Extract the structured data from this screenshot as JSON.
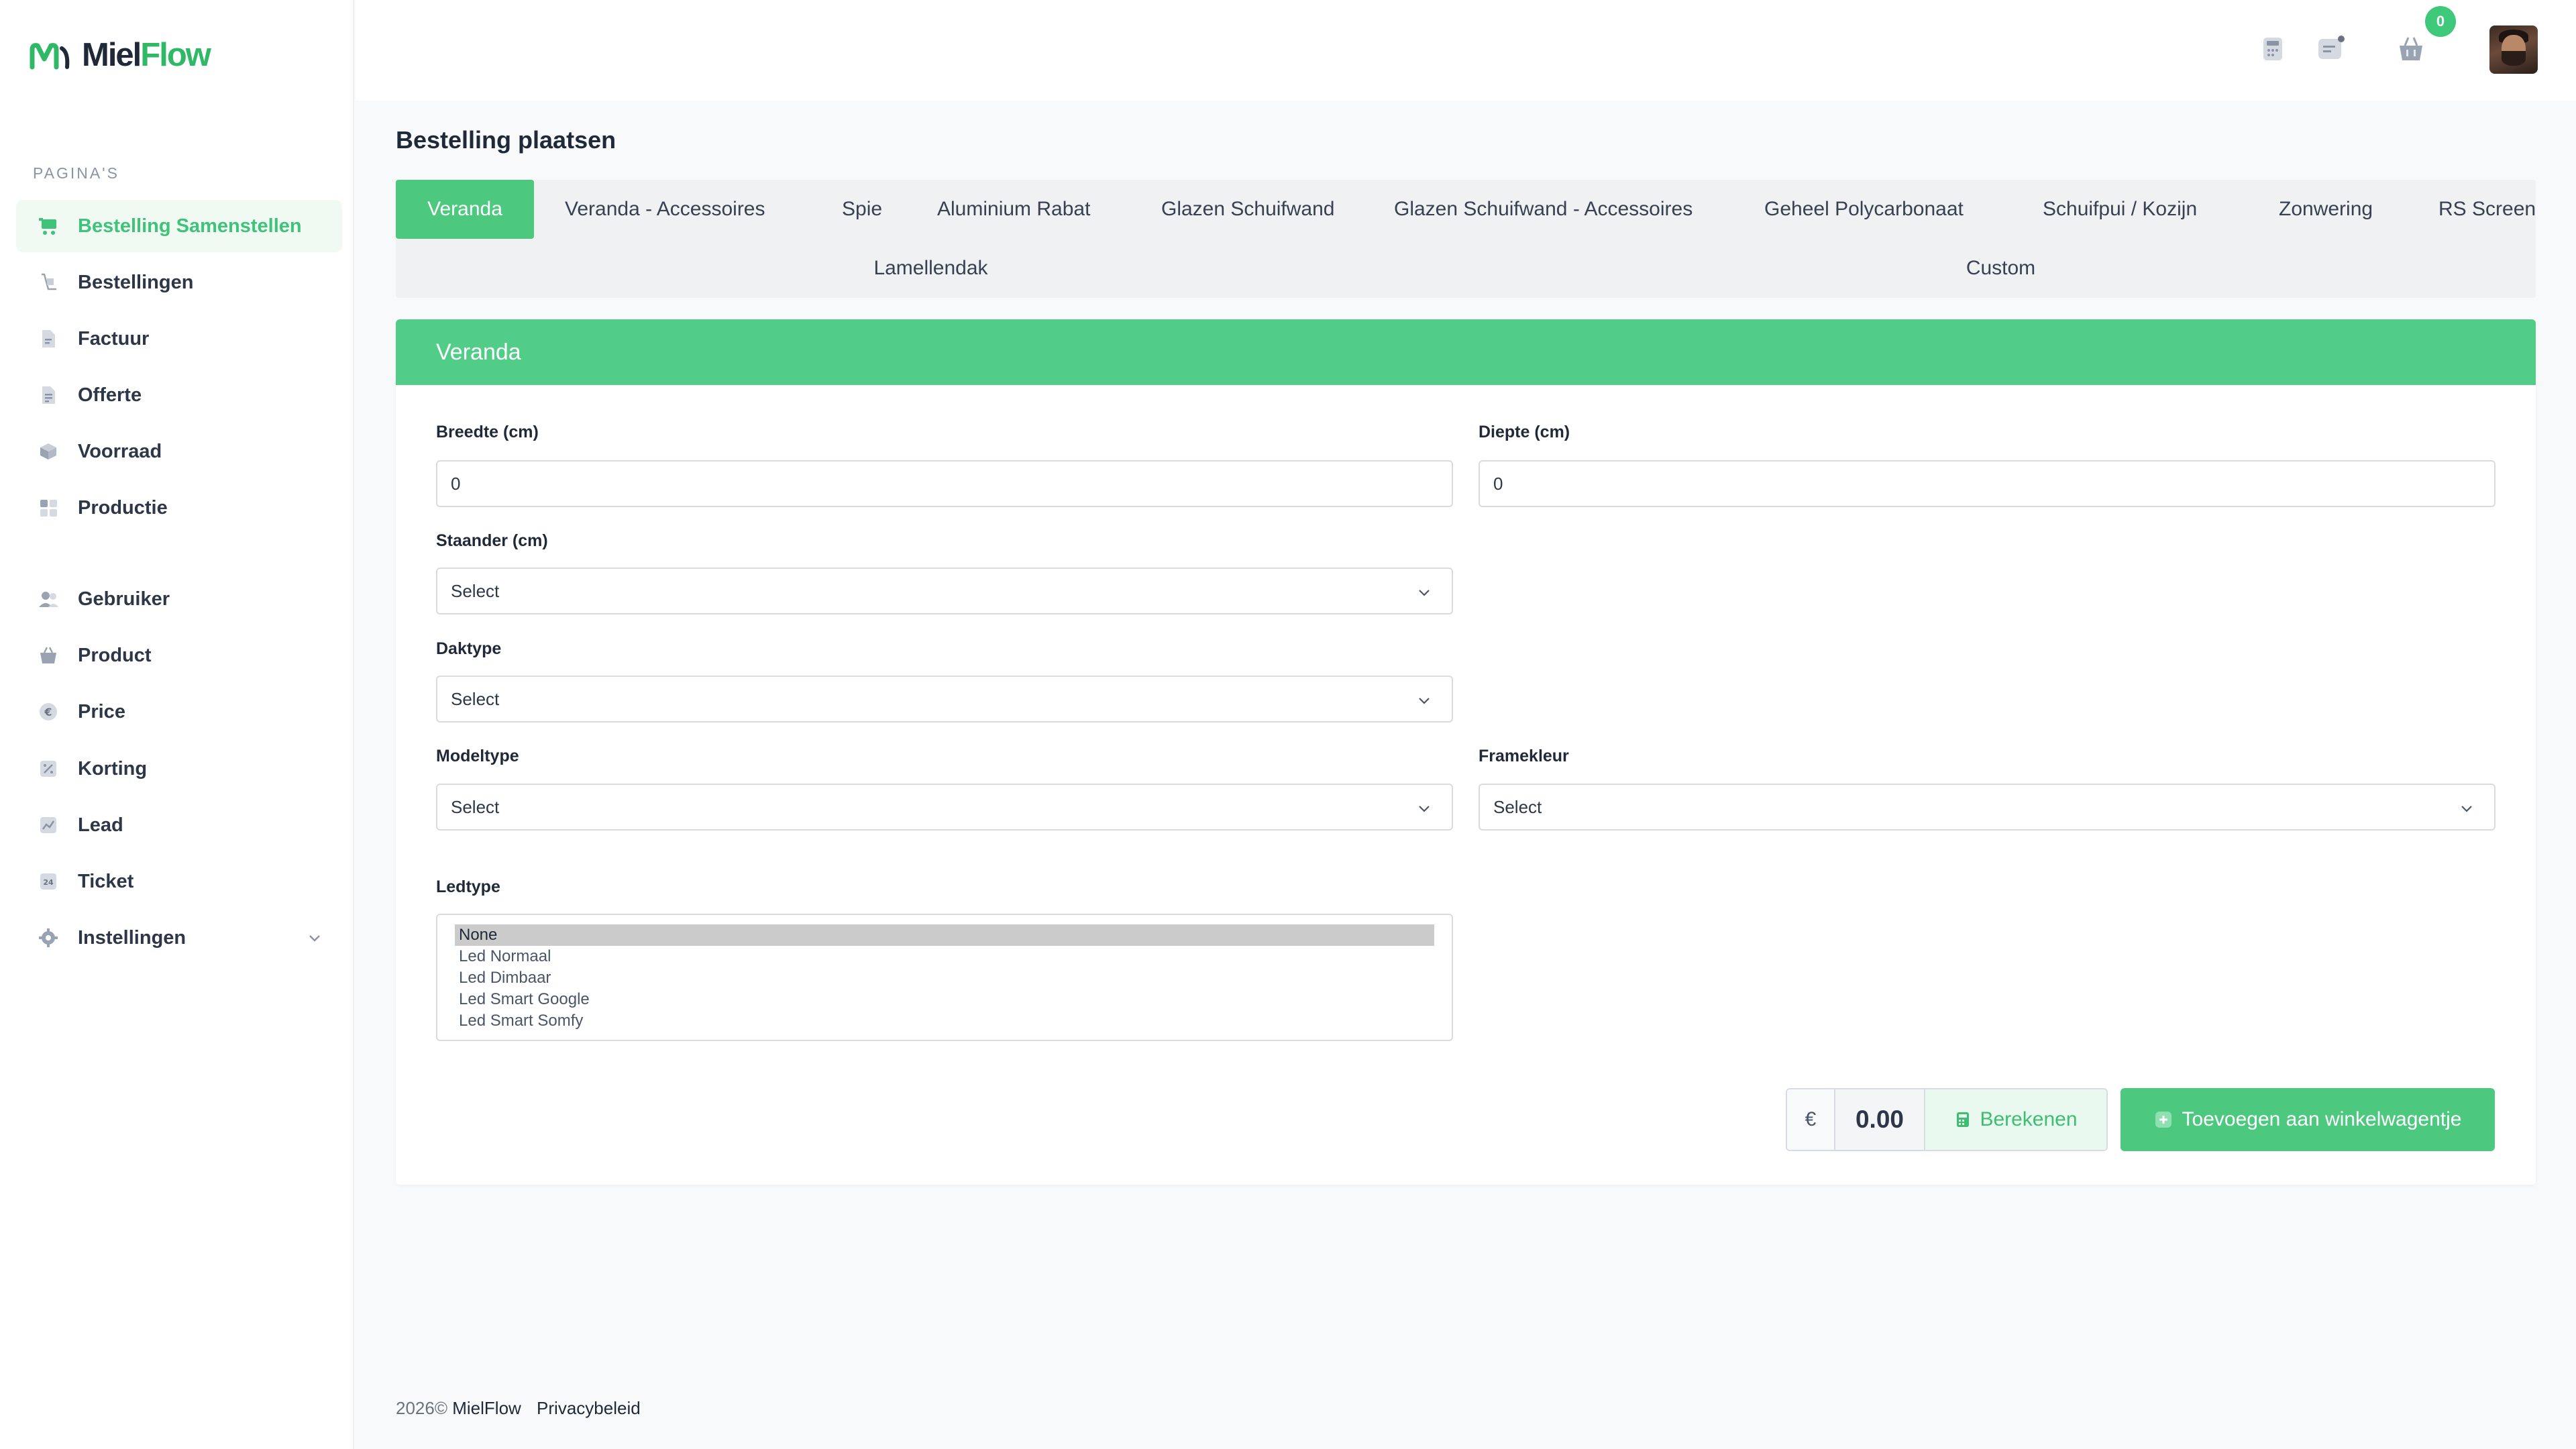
{
  "app": {
    "logo_prefix": "Miel",
    "logo_suffix": "Flow"
  },
  "sidebar": {
    "section_label": "PAGINA'S",
    "items": [
      {
        "label": "Bestelling Samenstellen",
        "icon": "cart-icon",
        "active": true
      },
      {
        "label": "Bestellingen",
        "icon": "orders-icon"
      },
      {
        "label": "Factuur",
        "icon": "invoice-icon"
      },
      {
        "label": "Offerte",
        "icon": "quote-icon"
      },
      {
        "label": "Voorraad",
        "icon": "stock-icon"
      },
      {
        "label": "Productie",
        "icon": "production-icon"
      },
      {
        "label": "Gebruiker",
        "icon": "users-icon"
      },
      {
        "label": "Product",
        "icon": "basket-icon"
      },
      {
        "label": "Price",
        "icon": "euro-icon"
      },
      {
        "label": "Korting",
        "icon": "discount-icon"
      },
      {
        "label": "Lead",
        "icon": "chart-icon"
      },
      {
        "label": "Ticket",
        "icon": "ticket-icon"
      },
      {
        "label": "Instellingen",
        "icon": "gear-icon"
      }
    ]
  },
  "topbar": {
    "cart_count": "0"
  },
  "page": {
    "title": "Bestelling plaatsen"
  },
  "tabs": [
    "Veranda",
    "Veranda - Accessoires",
    "Spie",
    "Aluminium Rabat",
    "Glazen Schuifwand",
    "Glazen Schuifwand - Accessoires",
    "Geheel Polycarbonaat",
    "Schuifpui / Kozijn",
    "Zonwering",
    "RS Screen",
    "Lamellendak",
    "Custom"
  ],
  "form": {
    "header": "Veranda",
    "breedte_label": "Breedte (cm)",
    "breedte_value": "0",
    "diepte_label": "Diepte (cm)",
    "diepte_value": "0",
    "staander_label": "Staander (cm)",
    "staander_value": "Select",
    "daktype_label": "Daktype",
    "daktype_value": "Select",
    "modeltype_label": "Modeltype",
    "modeltype_value": "Select",
    "framekleur_label": "Framekleur",
    "framekleur_value": "Select",
    "ledtype_label": "Ledtype",
    "ledtype_options": [
      "None",
      "Led Normaal",
      "Led Dimbaar",
      "Led Smart Google",
      "Led Smart Somfy"
    ],
    "ledtype_selected": "None"
  },
  "actions": {
    "currency": "€",
    "price": "0.00",
    "calculate_label": "Berekenen",
    "add_to_cart_label": "Toevoegen aan winkelwagentje"
  },
  "footer": {
    "copyright": "2026©",
    "brand": "MielFlow",
    "privacy": "Privacybeleid"
  },
  "colors": {
    "accent": "#4cc97f",
    "card_header": "#52cd88",
    "active_nav_text": "#3fc27a"
  }
}
